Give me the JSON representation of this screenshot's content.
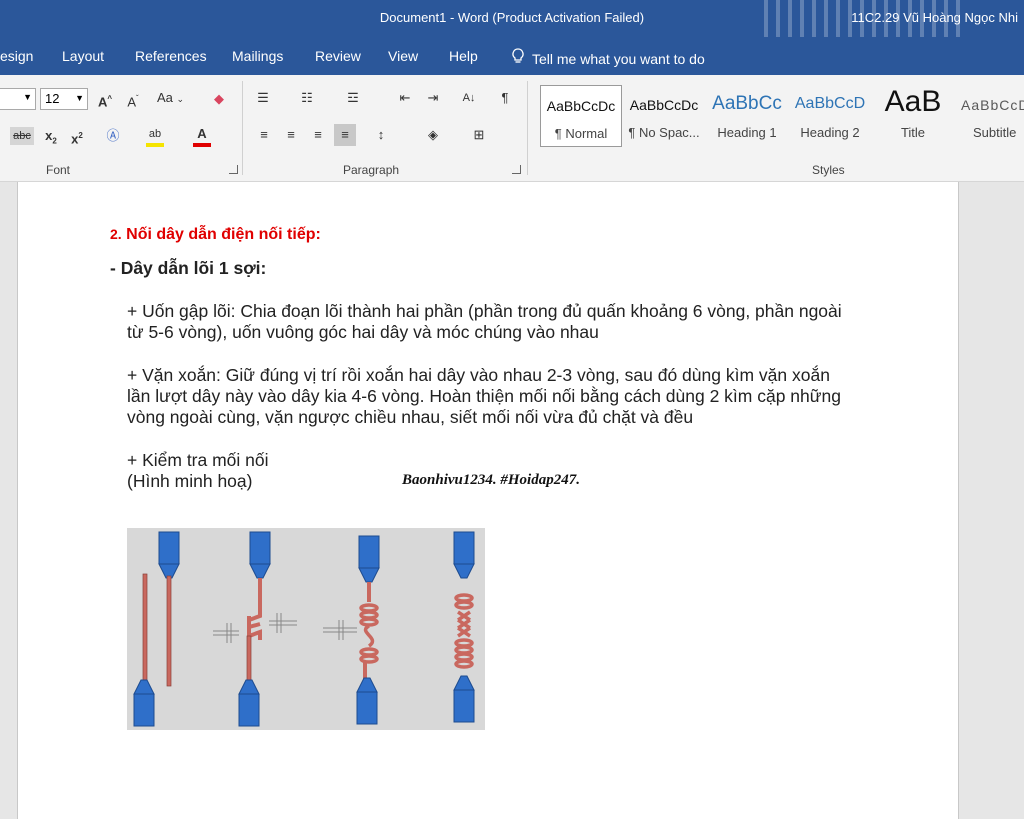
{
  "window": {
    "title": "Document1  -  Word (Product Activation Failed)",
    "user": "11C2.29 Vũ Hoàng Ngọc Nhi"
  },
  "tabs": [
    "esign",
    "Layout",
    "References",
    "Mailings",
    "Review",
    "View",
    "Help"
  ],
  "tell_me": "Tell me what you want to do",
  "ribbon": {
    "font_size": "12",
    "font_group_label": "Font",
    "paragraph_group_label": "Paragraph",
    "styles_group_label": "Styles",
    "change_case_label": "Aa",
    "styles": [
      {
        "sample": "AaBbCcDc",
        "name": "¶ Normal",
        "selected": true
      },
      {
        "sample": "AaBbCcDc",
        "name": "¶ No Spac..."
      },
      {
        "sample": "AaBbCc",
        "name": "Heading 1"
      },
      {
        "sample": "AaBbCcD",
        "name": "Heading 2"
      },
      {
        "sample": "AaB",
        "name": "Title"
      },
      {
        "sample": "AaBbCcD",
        "name": "Subtitle"
      }
    ]
  },
  "document": {
    "heading_number": "2.",
    "heading_text": "Nối dây dẫn điện nối tiếp:",
    "subheading": "- Dây dẫn lõi 1 sợi:",
    "para1": "+ Uốn gập lõi: Chia đoạn lõi thành hai phần (phần trong đủ quấn khoảng 6 vòng, phần ngoài từ 5-6 vòng), uốn vuông góc hai dây và móc chúng vào nhau",
    "para2": "+ Vặn xoắn: Giữ đúng vị trí rồi xoắn hai dây vào nhau 2-3 vòng, sau đó dùng kìm vặn xoắn lần lượt dây này vào dây kia 4-6 vòng. Hoàn thiện mối nối bằng cách dùng 2 kìm cặp những vòng ngoài cùng, vặn ngược chiều nhau, siết mối nối vừa đủ chặt và đều",
    "check": "+ Kiểm tra mối nối",
    "illustration": "(Hình minh hoạ)",
    "credit": "Baonhivu1234. #Hoidap247."
  },
  "colors": {
    "accent": "#2b579a",
    "heading_red": "#e00000",
    "wire": "#c9685f",
    "insulation": "#2f6fc9"
  }
}
